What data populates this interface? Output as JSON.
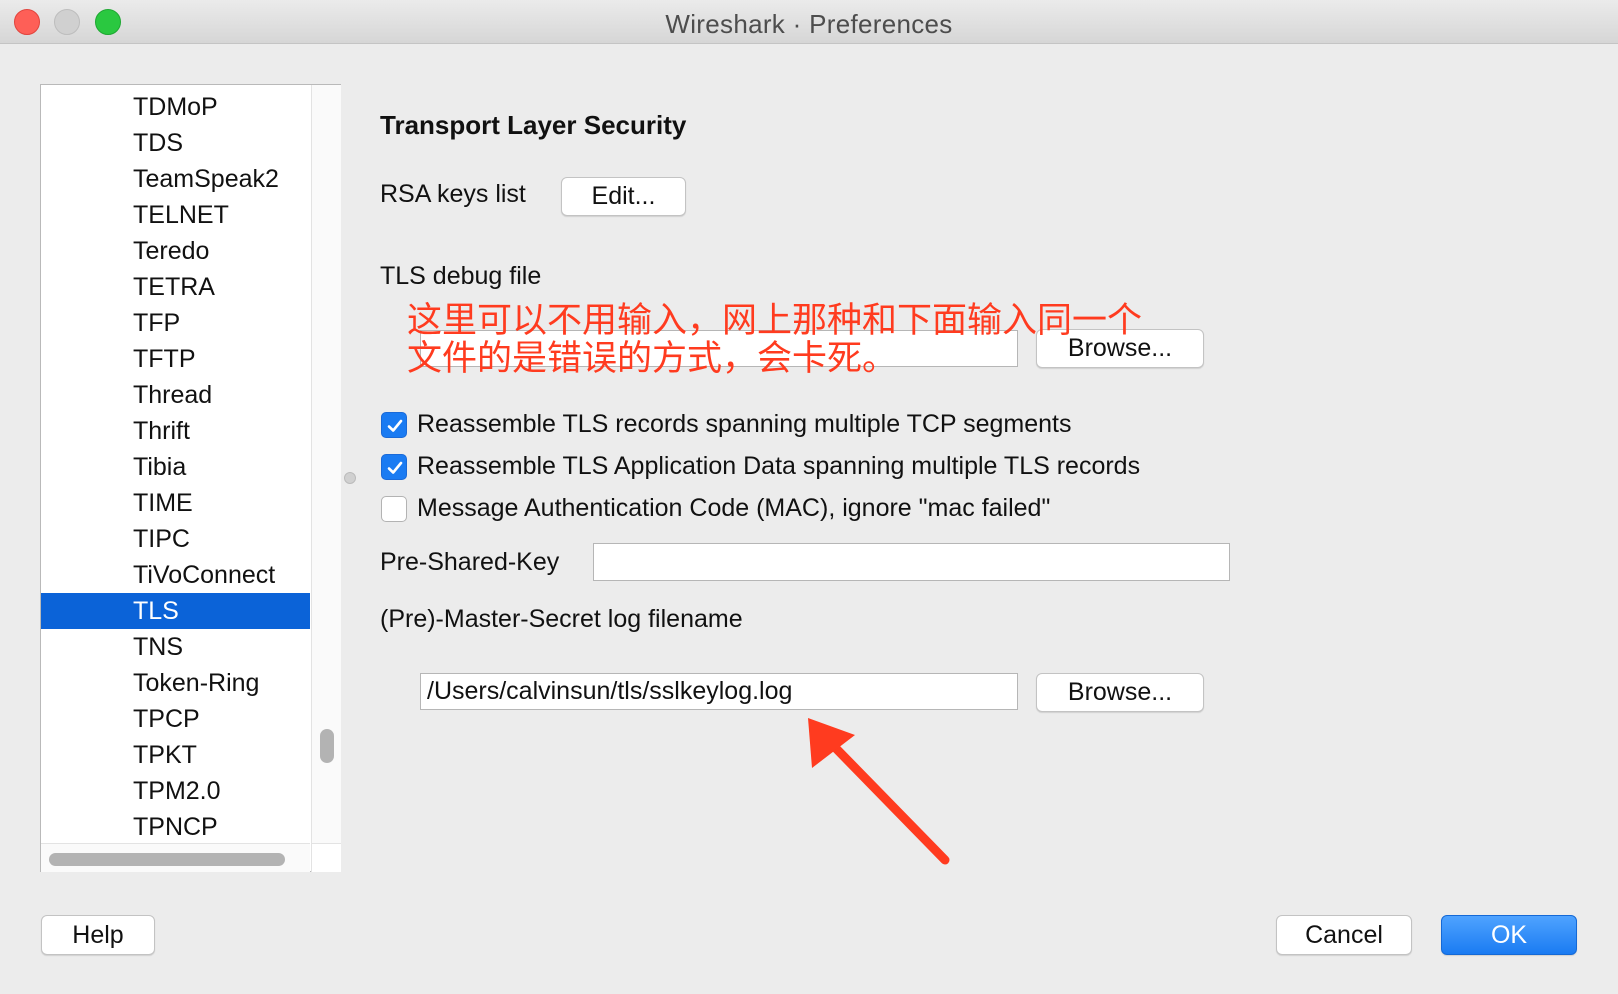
{
  "window": {
    "title": "Wireshark · Preferences"
  },
  "sidebar": {
    "items": [
      {
        "label": "TDMoP",
        "selected": false
      },
      {
        "label": "TDS",
        "selected": false
      },
      {
        "label": "TeamSpeak2",
        "selected": false
      },
      {
        "label": "TELNET",
        "selected": false
      },
      {
        "label": "Teredo",
        "selected": false
      },
      {
        "label": "TETRA",
        "selected": false
      },
      {
        "label": "TFP",
        "selected": false
      },
      {
        "label": "TFTP",
        "selected": false
      },
      {
        "label": "Thread",
        "selected": false
      },
      {
        "label": "Thrift",
        "selected": false
      },
      {
        "label": "Tibia",
        "selected": false
      },
      {
        "label": "TIME",
        "selected": false
      },
      {
        "label": "TIPC",
        "selected": false
      },
      {
        "label": "TiVoConnect",
        "selected": false
      },
      {
        "label": "TLS",
        "selected": true
      },
      {
        "label": "TNS",
        "selected": false
      },
      {
        "label": "Token-Ring",
        "selected": false
      },
      {
        "label": "TPCP",
        "selected": false
      },
      {
        "label": "TPKT",
        "selected": false
      },
      {
        "label": "TPM2.0",
        "selected": false
      },
      {
        "label": "TPNCP",
        "selected": false
      }
    ]
  },
  "main": {
    "section_title": "Transport Layer Security",
    "rsa_label": "RSA keys list",
    "rsa_edit_button": "Edit...",
    "debug_file_label": "TLS debug file",
    "debug_file_value": "",
    "debug_browse_button": "Browse...",
    "checkboxes": [
      {
        "label": "Reassemble TLS records spanning multiple TCP segments",
        "checked": true
      },
      {
        "label": "Reassemble TLS Application Data spanning multiple TLS records",
        "checked": true
      },
      {
        "label": "Message Authentication Code (MAC), ignore \"mac failed\"",
        "checked": false
      }
    ],
    "psk_label": "Pre-Shared-Key",
    "psk_value": "",
    "master_secret_label": "(Pre)-Master-Secret log filename",
    "master_secret_value": "/Users/calvinsun/tls/sslkeylog.log",
    "master_browse_button": "Browse..."
  },
  "annotation": {
    "line1": "这里可以不用输入，网上那种和下面输入同一个",
    "line2": "文件的是错误的方式，会卡死。",
    "color": "#ff3b1f"
  },
  "footer": {
    "help_button": "Help",
    "cancel_button": "Cancel",
    "ok_button": "OK"
  },
  "colors": {
    "selection": "#0b63d8",
    "accent": "#1a7bf2"
  }
}
